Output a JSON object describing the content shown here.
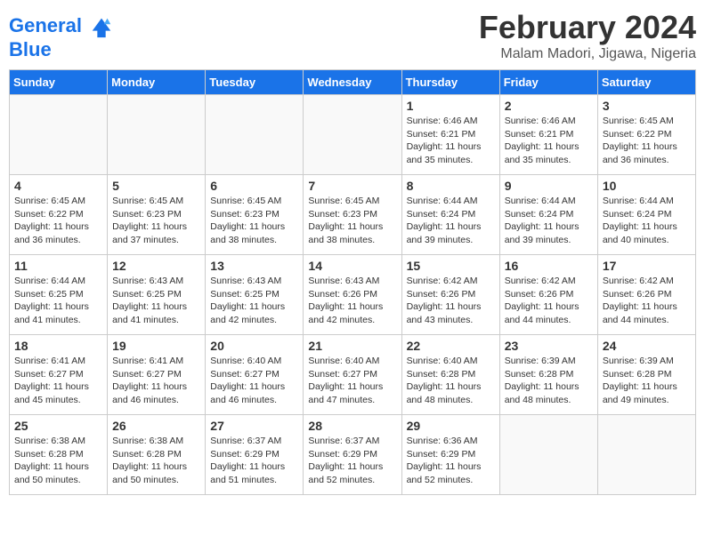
{
  "header": {
    "logo_line1": "General",
    "logo_line2": "Blue",
    "title": "February 2024",
    "subtitle": "Malam Madori, Jigawa, Nigeria"
  },
  "days_of_week": [
    "Sunday",
    "Monday",
    "Tuesday",
    "Wednesday",
    "Thursday",
    "Friday",
    "Saturday"
  ],
  "weeks": [
    [
      {
        "day": "",
        "info": ""
      },
      {
        "day": "",
        "info": ""
      },
      {
        "day": "",
        "info": ""
      },
      {
        "day": "",
        "info": ""
      },
      {
        "day": "1",
        "info": "Sunrise: 6:46 AM\nSunset: 6:21 PM\nDaylight: 11 hours\nand 35 minutes."
      },
      {
        "day": "2",
        "info": "Sunrise: 6:46 AM\nSunset: 6:21 PM\nDaylight: 11 hours\nand 35 minutes."
      },
      {
        "day": "3",
        "info": "Sunrise: 6:45 AM\nSunset: 6:22 PM\nDaylight: 11 hours\nand 36 minutes."
      }
    ],
    [
      {
        "day": "4",
        "info": "Sunrise: 6:45 AM\nSunset: 6:22 PM\nDaylight: 11 hours\nand 36 minutes."
      },
      {
        "day": "5",
        "info": "Sunrise: 6:45 AM\nSunset: 6:23 PM\nDaylight: 11 hours\nand 37 minutes."
      },
      {
        "day": "6",
        "info": "Sunrise: 6:45 AM\nSunset: 6:23 PM\nDaylight: 11 hours\nand 38 minutes."
      },
      {
        "day": "7",
        "info": "Sunrise: 6:45 AM\nSunset: 6:23 PM\nDaylight: 11 hours\nand 38 minutes."
      },
      {
        "day": "8",
        "info": "Sunrise: 6:44 AM\nSunset: 6:24 PM\nDaylight: 11 hours\nand 39 minutes."
      },
      {
        "day": "9",
        "info": "Sunrise: 6:44 AM\nSunset: 6:24 PM\nDaylight: 11 hours\nand 39 minutes."
      },
      {
        "day": "10",
        "info": "Sunrise: 6:44 AM\nSunset: 6:24 PM\nDaylight: 11 hours\nand 40 minutes."
      }
    ],
    [
      {
        "day": "11",
        "info": "Sunrise: 6:44 AM\nSunset: 6:25 PM\nDaylight: 11 hours\nand 41 minutes."
      },
      {
        "day": "12",
        "info": "Sunrise: 6:43 AM\nSunset: 6:25 PM\nDaylight: 11 hours\nand 41 minutes."
      },
      {
        "day": "13",
        "info": "Sunrise: 6:43 AM\nSunset: 6:25 PM\nDaylight: 11 hours\nand 42 minutes."
      },
      {
        "day": "14",
        "info": "Sunrise: 6:43 AM\nSunset: 6:26 PM\nDaylight: 11 hours\nand 42 minutes."
      },
      {
        "day": "15",
        "info": "Sunrise: 6:42 AM\nSunset: 6:26 PM\nDaylight: 11 hours\nand 43 minutes."
      },
      {
        "day": "16",
        "info": "Sunrise: 6:42 AM\nSunset: 6:26 PM\nDaylight: 11 hours\nand 44 minutes."
      },
      {
        "day": "17",
        "info": "Sunrise: 6:42 AM\nSunset: 6:26 PM\nDaylight: 11 hours\nand 44 minutes."
      }
    ],
    [
      {
        "day": "18",
        "info": "Sunrise: 6:41 AM\nSunset: 6:27 PM\nDaylight: 11 hours\nand 45 minutes."
      },
      {
        "day": "19",
        "info": "Sunrise: 6:41 AM\nSunset: 6:27 PM\nDaylight: 11 hours\nand 46 minutes."
      },
      {
        "day": "20",
        "info": "Sunrise: 6:40 AM\nSunset: 6:27 PM\nDaylight: 11 hours\nand 46 minutes."
      },
      {
        "day": "21",
        "info": "Sunrise: 6:40 AM\nSunset: 6:27 PM\nDaylight: 11 hours\nand 47 minutes."
      },
      {
        "day": "22",
        "info": "Sunrise: 6:40 AM\nSunset: 6:28 PM\nDaylight: 11 hours\nand 48 minutes."
      },
      {
        "day": "23",
        "info": "Sunrise: 6:39 AM\nSunset: 6:28 PM\nDaylight: 11 hours\nand 48 minutes."
      },
      {
        "day": "24",
        "info": "Sunrise: 6:39 AM\nSunset: 6:28 PM\nDaylight: 11 hours\nand 49 minutes."
      }
    ],
    [
      {
        "day": "25",
        "info": "Sunrise: 6:38 AM\nSunset: 6:28 PM\nDaylight: 11 hours\nand 50 minutes."
      },
      {
        "day": "26",
        "info": "Sunrise: 6:38 AM\nSunset: 6:28 PM\nDaylight: 11 hours\nand 50 minutes."
      },
      {
        "day": "27",
        "info": "Sunrise: 6:37 AM\nSunset: 6:29 PM\nDaylight: 11 hours\nand 51 minutes."
      },
      {
        "day": "28",
        "info": "Sunrise: 6:37 AM\nSunset: 6:29 PM\nDaylight: 11 hours\nand 52 minutes."
      },
      {
        "day": "29",
        "info": "Sunrise: 6:36 AM\nSunset: 6:29 PM\nDaylight: 11 hours\nand 52 minutes."
      },
      {
        "day": "",
        "info": ""
      },
      {
        "day": "",
        "info": ""
      }
    ]
  ]
}
